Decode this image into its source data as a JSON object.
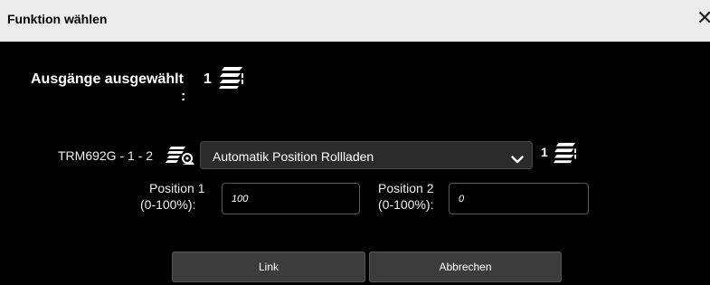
{
  "dialog": {
    "title": "Funktion wählen",
    "close_symbol": "✕"
  },
  "selected": {
    "label": "Ausgänge ausgewählt",
    "colon": ":",
    "count": "1",
    "icon": "output-stack-icon"
  },
  "device": {
    "label": "TRM692G - 1 - 2",
    "icon": "device-settings-icon"
  },
  "function_select": {
    "value": "Automatik Position Rollladen",
    "icon": "chevron-down-icon"
  },
  "function_count": {
    "count": "1",
    "icon": "output-stack-icon"
  },
  "position1": {
    "label_line1": "Position 1",
    "label_line2": "(0-100%):",
    "value": "100"
  },
  "position2": {
    "label_line1": "Position 2",
    "label_line2": "(0-100%):",
    "value": "0"
  },
  "buttons": {
    "link": "Link",
    "cancel": "Abbrechen"
  },
  "colors": {
    "background": "#000000",
    "titlebar": "#ececec",
    "button": "#3c3c3c",
    "select": "#2b2b2b"
  }
}
